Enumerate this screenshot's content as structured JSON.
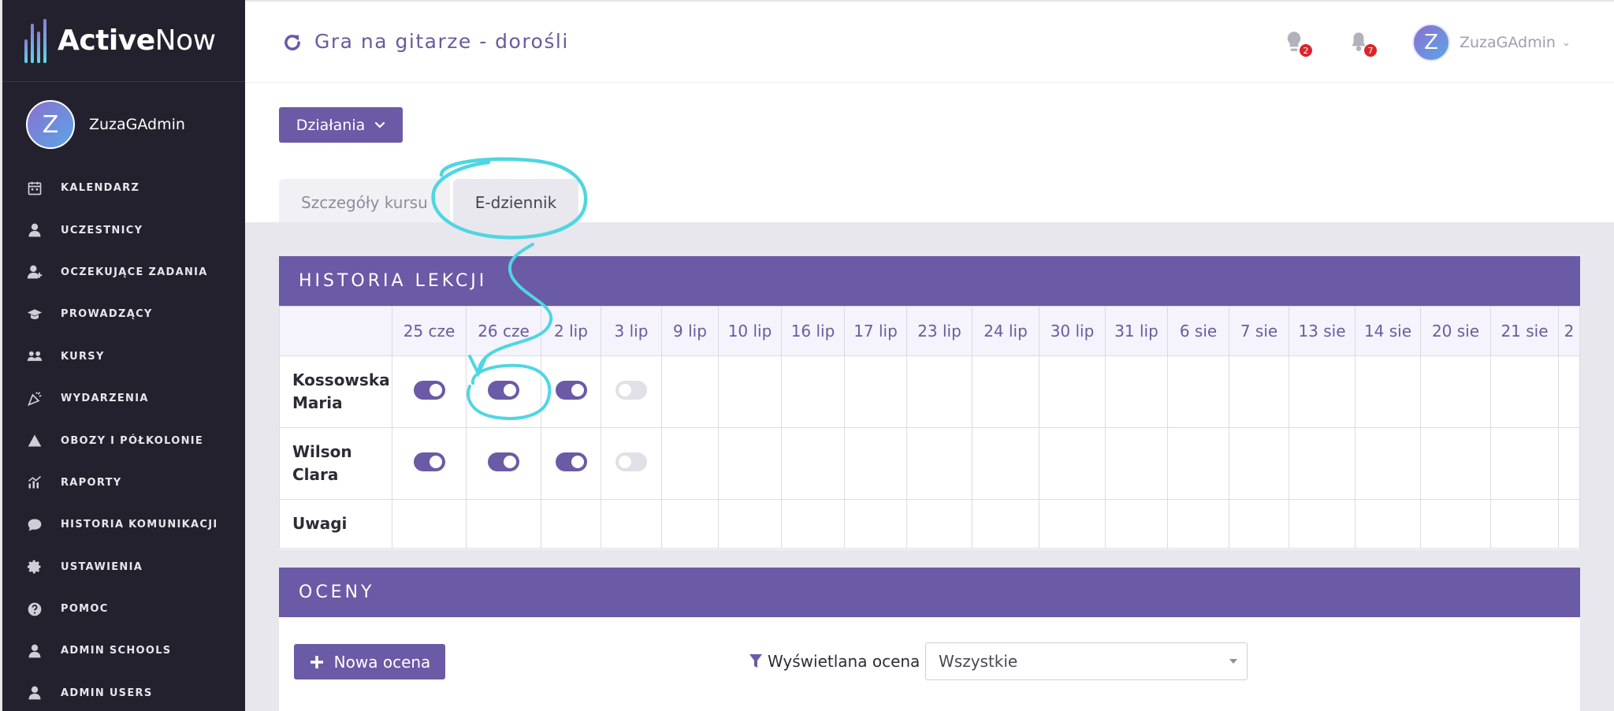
{
  "app": {
    "brand_bold": "Active",
    "brand_light": "Now"
  },
  "sidebar": {
    "user_name": "ZuzaGAdmin",
    "avatar_letter": "Z",
    "items": [
      {
        "label": "KALENDARZ",
        "icon": "calendar-icon"
      },
      {
        "label": "UCZESTNICY",
        "icon": "user-icon"
      },
      {
        "label": "OCZEKUJĄCE ZADANIA",
        "icon": "user-plus-icon"
      },
      {
        "label": "PROWADZĄCY",
        "icon": "graduation-cap-icon"
      },
      {
        "label": "KURSY",
        "icon": "users-group-icon"
      },
      {
        "label": "WYDARZENIA",
        "icon": "party-popper-icon"
      },
      {
        "label": "OBOZY I PÓŁKOLONIE",
        "icon": "tent-icon"
      },
      {
        "label": "RAPORTY",
        "icon": "bar-chart-icon"
      },
      {
        "label": "HISTORIA KOMUNIKACJI",
        "icon": "chat-icon"
      },
      {
        "label": "USTAWIENIA",
        "icon": "gear-icon"
      },
      {
        "label": "POMOC",
        "icon": "help-icon"
      },
      {
        "label": "ADMIN SCHOOLS",
        "icon": "user-icon"
      },
      {
        "label": "ADMIN USERS",
        "icon": "user-icon"
      }
    ]
  },
  "header": {
    "title": "Gra na gitarze - dorośli",
    "messages_badge": "2",
    "notifications_badge": "7",
    "user_name": "ZuzaGAdmin",
    "avatar_letter": "Z"
  },
  "main": {
    "actions_label": "Działania",
    "tabs": [
      {
        "label": "Szczegóły kursu",
        "active": false
      },
      {
        "label": "E-dziennik",
        "active": true
      }
    ],
    "history": {
      "title": "HISTORIA LEKCJI",
      "dates": [
        "25 cze",
        "26 cze",
        "2 lip",
        "3 lip",
        "9 lip",
        "10 lip",
        "16 lip",
        "17 lip",
        "23 lip",
        "24 lip",
        "30 lip",
        "31 lip",
        "6 sie",
        "7 sie",
        "13 sie",
        "14 sie",
        "20 sie",
        "21 sie",
        "2"
      ],
      "rows": [
        {
          "name": "Kossowska Maria",
          "attendance": [
            "on",
            "on",
            "on",
            "off"
          ]
        },
        {
          "name": "Wilson Clara",
          "attendance": [
            "on",
            "on",
            "on",
            "off"
          ]
        }
      ],
      "notes_label": "Uwagi"
    },
    "grades": {
      "title": "OCENY",
      "new_label": "Nowa ocena",
      "filter_label": "Wyświetlana ocena",
      "filter_value": "Wszystkie"
    }
  },
  "colors": {
    "primary": "#6b5aa5",
    "sidebar": "#24212f",
    "annotation": "#4fd6e0",
    "badge": "#d8262a"
  }
}
